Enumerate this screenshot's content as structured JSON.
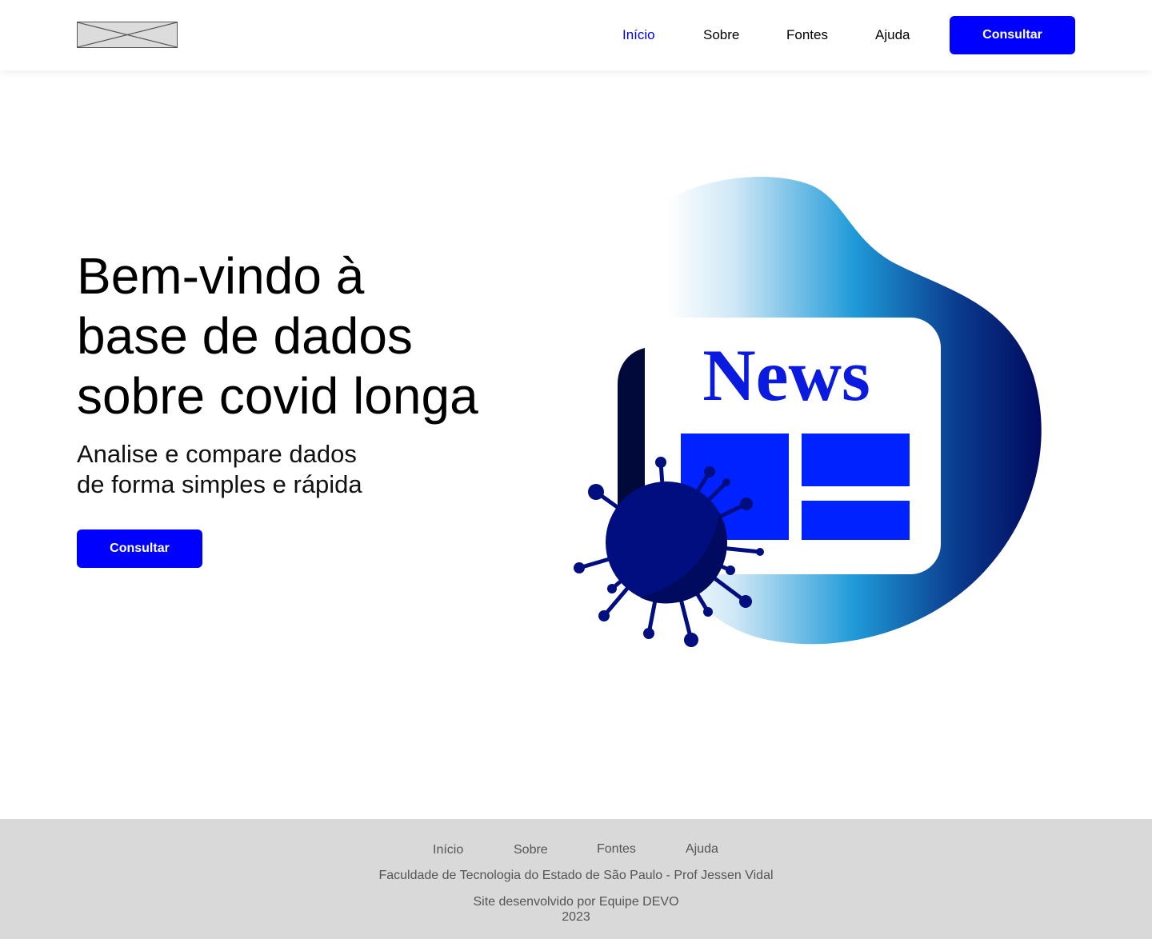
{
  "header": {
    "nav": [
      {
        "label": "Início",
        "active": true
      },
      {
        "label": "Sobre",
        "active": false
      },
      {
        "label": "Fontes",
        "active": false
      },
      {
        "label": "Ajuda",
        "active": false
      }
    ],
    "cta_label": "Consultar"
  },
  "hero": {
    "title_lines": [
      "Bem-vindo à",
      "base de dados",
      "sobre covid longa"
    ],
    "subtitle_lines": [
      "Analise e compare dados",
      "de forma simples e rápida"
    ],
    "cta_label": "Consultar",
    "illustration_text": "News"
  },
  "footer": {
    "nav": [
      "Início",
      "Sobre",
      "Fontes",
      "Ajuda"
    ],
    "institution": "Faculdade de Tecnologia do Estado de São Paulo - Prof Jessen Vidal",
    "credit": "Site desenvolvido por Equipe DEVO",
    "year": "2023"
  },
  "colors": {
    "accent": "#0000ff",
    "active_link": "#0000ee",
    "footer_bg": "#d9d9d9",
    "virus": "#000e80",
    "news_text": "#0a1adf"
  },
  "icons": [
    "logo-placeholder-icon",
    "newspaper-icon",
    "virus-icon"
  ]
}
